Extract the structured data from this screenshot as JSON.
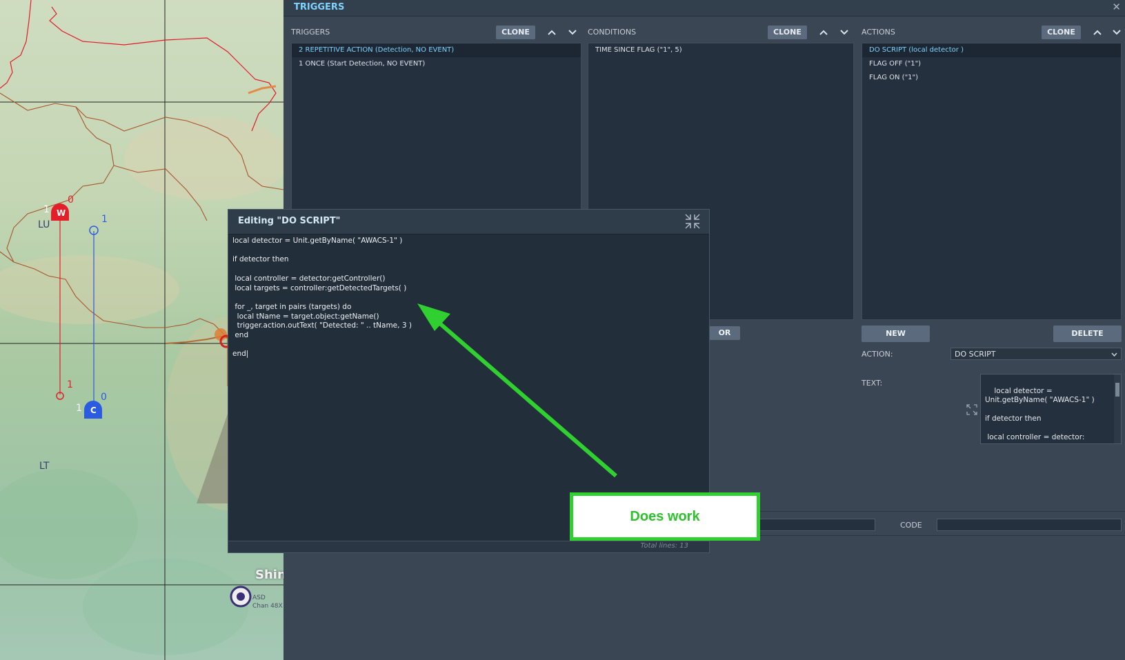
{
  "window": {
    "title": "TRIGGERS",
    "close_icon": "✕"
  },
  "triggers": {
    "header": "TRIGGERS",
    "clone_label": "CLONE",
    "items": [
      {
        "label": "2 REPETITIVE ACTION (Detection, NO EVENT)",
        "selected": true
      },
      {
        "label": "1 ONCE (Start Detection, NO EVENT)",
        "selected": false
      }
    ]
  },
  "conditions": {
    "header": "CONDITIONS",
    "clone_label": "CLONE",
    "items": [
      {
        "label": "TIME SINCE FLAG (\"1\", 5)",
        "selected": false
      }
    ],
    "or_label": "OR"
  },
  "actions": {
    "header": "ACTIONS",
    "clone_label": "CLONE",
    "items": [
      {
        "label": "DO SCRIPT (local detector )",
        "selected": true
      },
      {
        "label": "FLAG OFF (\"1\")",
        "selected": false
      },
      {
        "label": "FLAG ON (\"1\")",
        "selected": false
      }
    ],
    "new_label": "NEW",
    "delete_label": "DELETE",
    "action_label": "ACTION:",
    "action_value": "DO SCRIPT",
    "text_label": "TEXT:",
    "text_value": "local detector = Unit.getByName( \"AWACS-1\" )\n\nif detector then\n\n local controller = detector:\ngetController()",
    "code_label": "CODE"
  },
  "editor": {
    "title": "Editing \"DO SCRIPT\"",
    "code": "local detector = Unit.getByName( \"AWACS-1\" )\n\nif detector then\n\n local controller = detector:getController()\n local targets = controller:getDetectedTargets( )\n\n for _, target in pairs (targets) do\n  local tName = target.object:getName()\n  trigger.action.outText( \"Detected: \" .. tName, 3 )\n end\n\nend|",
    "total_lines_label": "Total lines:  13"
  },
  "annotation": {
    "text": "Does work"
  },
  "map": {
    "labels": [
      "LU",
      "LT",
      "Shin"
    ],
    "small_text": [
      "ASD",
      "Chan 48X"
    ],
    "units": [
      {
        "letter": "W",
        "left_num": "1",
        "right_num": "0",
        "bottom_num": "1",
        "color": "#e3202a"
      },
      {
        "letter": "C",
        "left_num": "1",
        "right_num": "0",
        "top_num": "1",
        "color": "#2a5be0"
      }
    ]
  },
  "colors": {
    "accent": "#7fd3ff",
    "callout_green": "#2fd02f",
    "panel_bg": "#3a4654",
    "list_bg": "#24303d"
  }
}
